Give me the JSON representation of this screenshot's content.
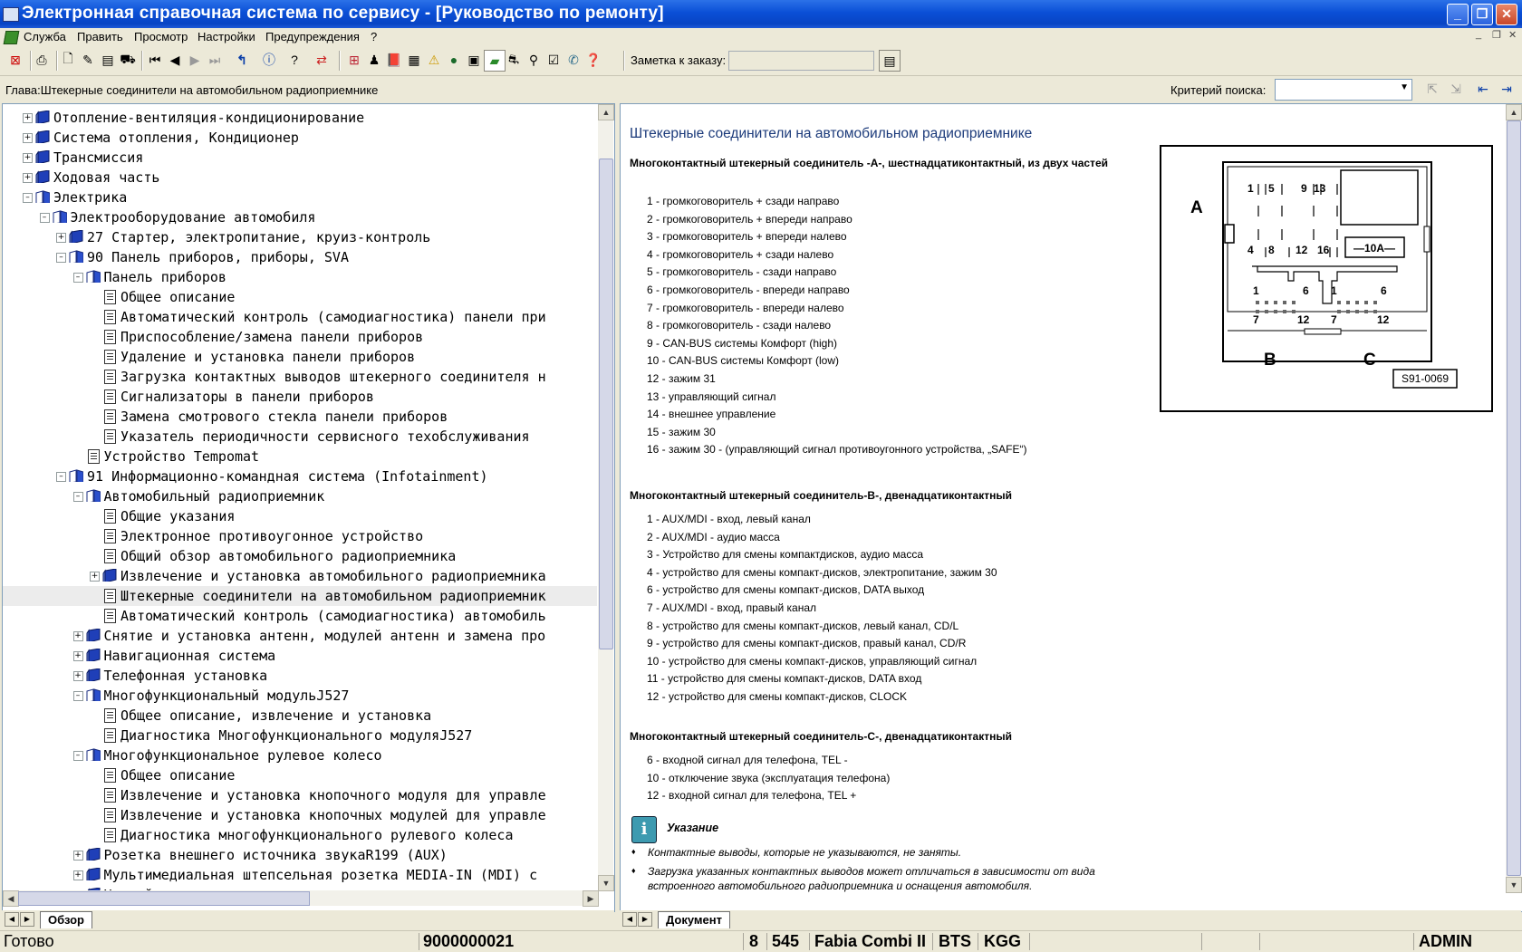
{
  "window": {
    "title": "Электронная справочная система по сервису - [Руководство по ремонту]"
  },
  "menubar": {
    "items": [
      "Служба",
      "Править",
      "Просмотр",
      "Настройки",
      "Предупреждения",
      "?"
    ]
  },
  "toolbar": {
    "order_note_label": "Заметка к заказу:",
    "order_note_value": ""
  },
  "infobar": {
    "chapter": "Глава:Штекерные соединители на автомобильном радиоприемнике",
    "search_label": "Критерий поиска:",
    "search_value": ""
  },
  "tree": {
    "items": [
      {
        "label": "Отопление-вентиляция-кондиционирование",
        "icon": "book-icon",
        "expander": "+"
      },
      {
        "label": "Система отопления, Кондиционер",
        "icon": "book-icon",
        "expander": "+"
      },
      {
        "label": "Трансмиссия",
        "icon": "book-icon",
        "expander": "+"
      },
      {
        "label": "Ходовая часть",
        "icon": "book-icon",
        "expander": "+"
      },
      {
        "label": "Электрика",
        "icon": "open-book-icon",
        "expander": "−"
      },
      {
        "label": "Электрооборудование автомобиля",
        "icon": "open-book-icon",
        "expander": "−"
      },
      {
        "label": "27 Стартер, электропитание, круиз-контроль",
        "icon": "book-icon",
        "expander": "+"
      },
      {
        "label": "90 Панель приборов, приборы, SVA",
        "icon": "open-book-icon",
        "expander": "−"
      },
      {
        "label": "Панель приборов",
        "icon": "open-book-icon",
        "expander": "−"
      },
      {
        "label": "Общее описание",
        "icon": "document-icon",
        "expander": ""
      },
      {
        "label": "Автоматический контроль (самодиагностика) панели при",
        "icon": "document-icon",
        "expander": ""
      },
      {
        "label": "Приспособление/замена панели приборов",
        "icon": "document-icon",
        "expander": ""
      },
      {
        "label": "Удаление и установка панели приборов",
        "icon": "document-icon",
        "expander": ""
      },
      {
        "label": "Загрузка контактных выводов штекерного соединителя н",
        "icon": "document-icon",
        "expander": ""
      },
      {
        "label": "Сигнализаторы в панели приборов",
        "icon": "document-icon",
        "expander": ""
      },
      {
        "label": "Замена смотрового стекла панели приборов",
        "icon": "document-icon",
        "expander": ""
      },
      {
        "label": "Указатель периодичности сервисного техобслуживания",
        "icon": "document-icon",
        "expander": ""
      },
      {
        "label": "Устройство Tempomat",
        "icon": "document-icon",
        "expander": ""
      },
      {
        "label": "91 Информационно-командная система (Infotainment)",
        "icon": "open-book-icon",
        "expander": "−"
      },
      {
        "label": "Автомобильный радиоприемник",
        "icon": "open-book-icon",
        "expander": "−"
      },
      {
        "label": "Общие указания",
        "icon": "document-icon",
        "expander": ""
      },
      {
        "label": "Электронное противоугонное устройство",
        "icon": "document-icon",
        "expander": ""
      },
      {
        "label": "Общий обзор автомобильного радиоприемника",
        "icon": "document-icon",
        "expander": ""
      },
      {
        "label": "Извлечение и установка автомобильного радиоприемника",
        "icon": "book-icon",
        "expander": "+"
      },
      {
        "label": "Штекерные соединители на автомобильном радиоприемник",
        "icon": "document-icon",
        "expander": ""
      },
      {
        "label": "Автоматический контроль (самодиагностика) автомобиль",
        "icon": "document-icon",
        "expander": ""
      },
      {
        "label": "Снятие и установка антенн, модулей антенн и замена про",
        "icon": "book-icon",
        "expander": "+"
      },
      {
        "label": "Навигационная система",
        "icon": "book-icon",
        "expander": "+"
      },
      {
        "label": "Телефонная установка",
        "icon": "book-icon",
        "expander": "+"
      },
      {
        "label": "Многофункциональный модульJ527",
        "icon": "open-book-icon",
        "expander": "−"
      },
      {
        "label": "Общее описание, извлечение и установка",
        "icon": "document-icon",
        "expander": ""
      },
      {
        "label": "Диагностика Многофункционального модуляJ527",
        "icon": "document-icon",
        "expander": ""
      },
      {
        "label": "Многофункциональное рулевое колесо",
        "icon": "open-book-icon",
        "expander": "−"
      },
      {
        "label": "Общее описание",
        "icon": "document-icon",
        "expander": ""
      },
      {
        "label": "Извлечение и установка кнопочного модуля для управле",
        "icon": "document-icon",
        "expander": ""
      },
      {
        "label": "Извлечение и установка кнопочных модулей для управле",
        "icon": "document-icon",
        "expander": ""
      },
      {
        "label": "Диагностика многофункционального рулевого колеса",
        "icon": "document-icon",
        "expander": ""
      },
      {
        "label": "Розетка внешнего источника звукаR199 (AUX)",
        "icon": "book-icon",
        "expander": "+"
      },
      {
        "label": "Мультимедиальная штепсельная розетка MEDIA-IN (MDI) с",
        "icon": "book-icon",
        "expander": "+"
      },
      {
        "label": "Устройство для смены компакт-дисков",
        "icon": "book-icon",
        "expander": "+"
      }
    ],
    "tab_label": "Обзор"
  },
  "document": {
    "title": "Штекерные соединители на автомобильном радиоприемнике",
    "sectionA": {
      "heading": "Многоконтактный штекерный соединитель -A-, шестнадцатиконтактный, из двух частей",
      "pins": [
        "1 - громкоговоритель + сзади направо",
        "2 - громкоговоритель + впереди направо",
        "3 - громкоговоритель + впереди налево",
        "4 - громкоговоритель + сзади налево",
        "5 - громкоговоритель - сзади направо",
        "6 - громкоговоритель - впереди направо",
        "7 - громкоговоритель - впереди налево",
        "8 - громкоговоритель - сзади налево",
        "9 - CAN-BUS системы Комфорт (high)",
        "10 - CAN-BUS системы Комфорт (low)",
        "12 - зажим 31",
        "13 - управляющий сигнал",
        "14 - внешнее управление",
        "15 - зажим 30",
        "16 - зажим 30 - (управляющий сигнал противоугонного устройства, „SAFE“)"
      ]
    },
    "sectionB": {
      "heading": "Многоконтактный штекерный соединитель-B-, двенадцатиконтактный",
      "pins": [
        "1 - AUX/MDI - вход, левый канал",
        "2 - AUX/MDI - аудио масса",
        "3 - Устройство для смены компактдисков, аудио масса",
        "4 - устройство для смены компакт-дисков, электропитание, зажим 30",
        "6 - устройство для смены компакт-дисков, DATA выход",
        "7 - AUX/MDI - вход, правый канал",
        "8 - устройство для смены компакт-дисков, левый канал, CD/L",
        "9 - устройство для смены компакт-дисков, правый канал, CD/R",
        "10 - устройство для смены компакт-дисков, управляющий сигнал",
        "11 - устройство для смены компакт-дисков, DATA вход",
        "12 - устройство для смены компакт-дисков, CLOCK"
      ]
    },
    "sectionC": {
      "heading": "Многоконтактный штекерный соединитель-C-, двенадцатиконтактный",
      "pins": [
        "6 - входной сигнал для телефона, TEL -",
        "10 - отключение звука (эксплуатация телефона)",
        "12 - входной сигнал для телефона, TEL +"
      ]
    },
    "note": {
      "title": "Указание",
      "bullets": [
        "Контактные выводы, которые не указываются, не заняты.",
        "Загрузка указанных контактных выводов может отличаться в зависимости от вида встроенного автомобильного радиоприемника и оснащения автомобиля."
      ]
    },
    "figure": {
      "label_a": "A",
      "label_b": "B",
      "label_c": "C",
      "fuse": "10A",
      "code": "S91-0069",
      "top_pins_row1": [
        "1",
        "5",
        "9",
        "13"
      ],
      "top_pins_row2": [
        "4",
        "8",
        "12",
        "16"
      ],
      "b_top": [
        "1",
        "6"
      ],
      "b_bottom": [
        "7",
        "12"
      ],
      "c_top": [
        "1",
        "6"
      ],
      "c_bottom": [
        "7",
        "12"
      ]
    },
    "tab_label": "Документ"
  },
  "statusbar": {
    "status": "Готово",
    "order_number": "9000000021",
    "c1": "8",
    "c2": "545",
    "model": "Fabia Combi II",
    "c3": "BTS",
    "c4": "KGG",
    "user": "ADMIN"
  }
}
